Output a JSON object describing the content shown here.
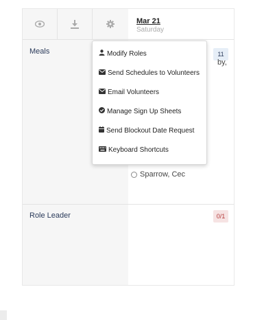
{
  "toolbar": {
    "buttons": [
      {
        "name": "view",
        "icon": "eye-icon"
      },
      {
        "name": "download",
        "icon": "download-icon"
      },
      {
        "name": "settings",
        "icon": "gear-icon"
      }
    ]
  },
  "date_column": {
    "date": "Mar 21",
    "weekday": "Saturday"
  },
  "rows": [
    {
      "label": "Meals",
      "badge": "11",
      "volunteers": [
        {
          "name": "Sparrow, Cec",
          "partial_text": "by,"
        }
      ]
    },
    {
      "label": "Role Leader",
      "badge": "0/1"
    }
  ],
  "menu": {
    "items": [
      {
        "label": "Modify Roles",
        "icon": "user-icon"
      },
      {
        "label": "Send Schedules to Volunteers",
        "icon": "envelope-icon"
      },
      {
        "label": "Email Volunteers",
        "icon": "envelope-icon"
      },
      {
        "label": "Manage Sign Up Sheets",
        "icon": "check-circle-icon"
      },
      {
        "label": "Send Blockout Date Request",
        "icon": "calendar-icon"
      },
      {
        "label": "Keyboard Shortcuts",
        "icon": "keyboard-icon"
      }
    ]
  },
  "colors": {
    "badge_blue_bg": "#e6eef7",
    "badge_red_bg": "#f6e3e3",
    "badge_red_text": "#b33a3a",
    "label_text": "#2a3a5a"
  }
}
